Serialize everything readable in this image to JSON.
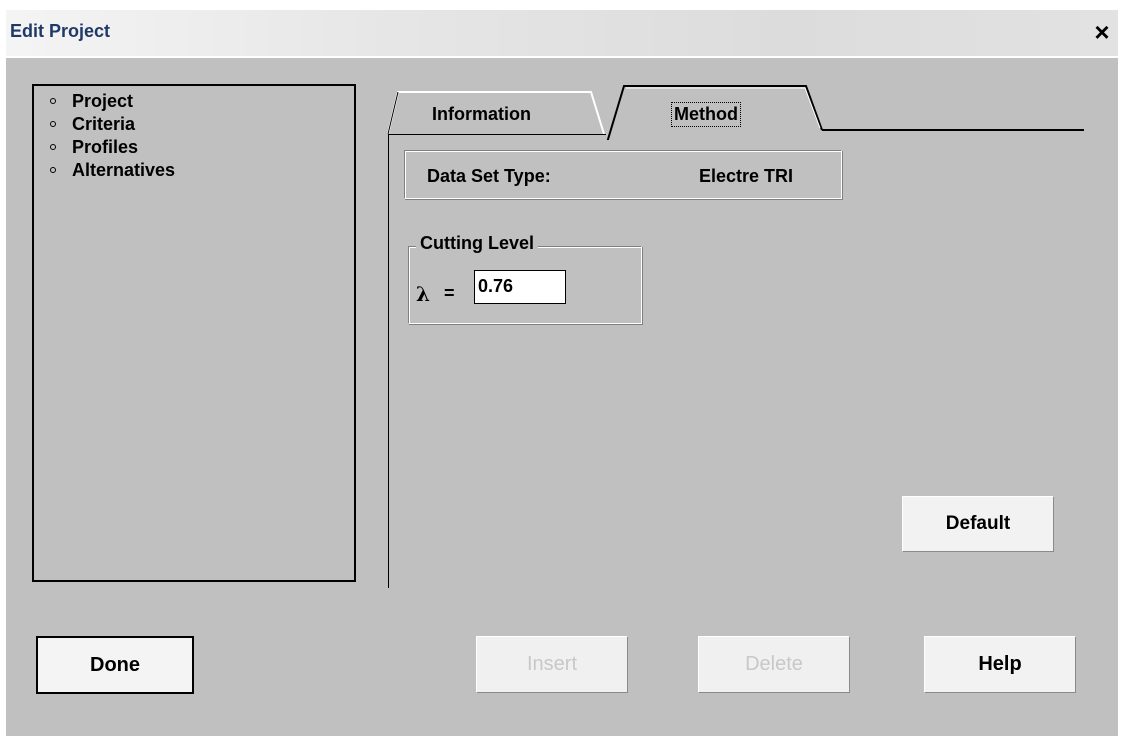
{
  "window": {
    "title": "Edit Project",
    "close_glyph": "×"
  },
  "sidebar": {
    "items": [
      {
        "label": "Project"
      },
      {
        "label": "Criteria"
      },
      {
        "label": "Profiles"
      },
      {
        "label": "Alternatives"
      }
    ]
  },
  "tabs": [
    {
      "label": "Information",
      "selected": false
    },
    {
      "label": "Method",
      "selected": true
    }
  ],
  "method_tab": {
    "data_set_type_label": "Data Set Type:",
    "data_set_type_value": "Electre TRI",
    "cutting_level": {
      "group_label": "Cutting Level",
      "lambda_symbol": "λ",
      "equals": "=",
      "value": "0.76"
    },
    "default_label": "Default"
  },
  "footer": {
    "done_label": "Done",
    "insert_label": "Insert",
    "delete_label": "Delete",
    "help_label": "Help"
  },
  "icons": {
    "close": "close-icon",
    "bullet": "bullet-icon"
  },
  "colors": {
    "window_bg": "#c0c0c0",
    "title_text": "#1f3a67",
    "disabled_text": "#c8c8c8"
  },
  "states": {
    "insert_enabled": false,
    "delete_enabled": false
  }
}
